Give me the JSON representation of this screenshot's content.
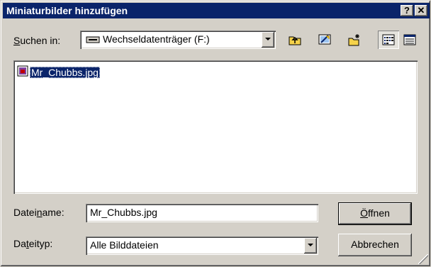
{
  "window": {
    "title": "Miniaturbilder hinzufügen",
    "help_label": "?",
    "close_label": "✕"
  },
  "lookin": {
    "label_prefix": "",
    "label_accel": "S",
    "label_rest": "uchen in:",
    "value": "Wechseldatenträger (F:)",
    "icon": "removable-drive-icon"
  },
  "toolbar": {
    "buttons": [
      {
        "name": "up-one-level",
        "icon": "folder-up-icon"
      },
      {
        "name": "desktop",
        "icon": "desktop-icon"
      },
      {
        "name": "new-folder",
        "icon": "new-folder-icon"
      },
      {
        "name": "list-view",
        "icon": "list-view-icon"
      },
      {
        "name": "details-view",
        "icon": "details-view-icon"
      }
    ]
  },
  "files": [
    {
      "name": "Mr_Chubbs.jpg",
      "icon": "image-file-icon",
      "selected": true
    }
  ],
  "filename": {
    "label_prefix": "Datei",
    "label_accel": "n",
    "label_rest": "ame:",
    "value": "Mr_Chubbs.jpg"
  },
  "filetype": {
    "label_prefix": "Da",
    "label_accel": "t",
    "label_rest": "eityp:",
    "value": "Alle Bilddateien"
  },
  "buttons": {
    "open_accel": "Ö",
    "open_rest": "ffnen",
    "cancel": "Abbrechen"
  },
  "colors": {
    "titlebar": "#0a246a",
    "face": "#d4d0c8",
    "selection": "#0a246a"
  }
}
